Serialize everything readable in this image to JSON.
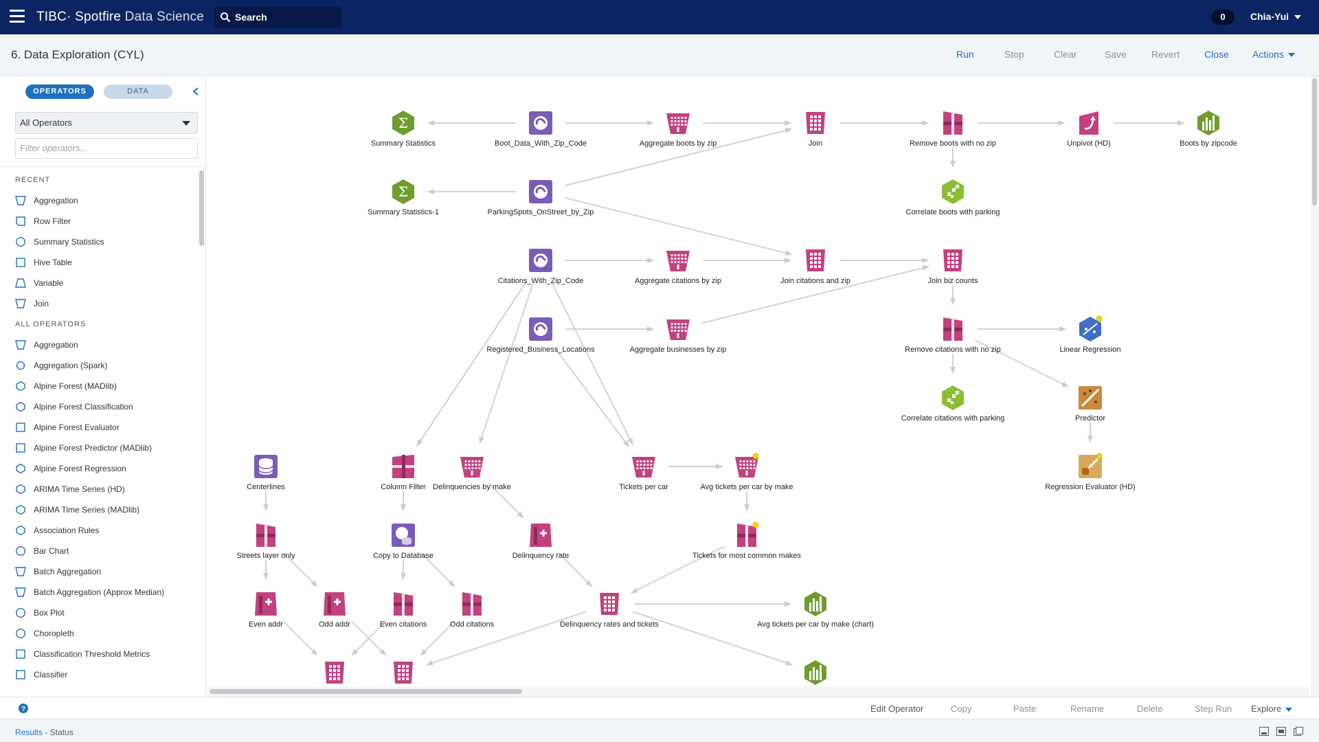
{
  "topbar": {
    "brand_main": "TIBC· Spotfire",
    "brand_sub": "Data Science",
    "search_label": "Search",
    "notifications": "0",
    "user": "Chia-Yui"
  },
  "titlebar": {
    "title": "6. Data Exploration (CYL)",
    "run": "Run",
    "stop": "Stop",
    "clear": "Clear",
    "save": "Save",
    "revert": "Revert",
    "close": "Close",
    "actions": "Actions"
  },
  "sidebar": {
    "tab_operators": "OPERATORS",
    "tab_data": "DATA",
    "select_value": "All Operators",
    "filter_placeholder": "Filter operators...",
    "recent_header": "RECENT",
    "recent": [
      "Aggregation",
      "Row Filter",
      "Summary Statistics",
      "Hive Table",
      "Variable",
      "Join"
    ],
    "all_header": "ALL OPERATORS",
    "all": [
      "Aggregation",
      "Aggregation (Spark)",
      "Alpine Forest (MADlib)",
      "Alpine Forest Classification",
      "Alpine Forest Evaluator",
      "Alpine Forest Predictor (MADlib)",
      "Alpine Forest Regression",
      "ARIMA Time Series (HD)",
      "ARIMA Time Series (MADlib)",
      "Association Rules",
      "Bar Chart",
      "Batch Aggregation",
      "Batch Aggregation (Approx Median)",
      "Box Plot",
      "Choropleth",
      "Classification Threshold Metrics",
      "Classifier"
    ]
  },
  "workflow": {
    "nodes": [
      {
        "label": "Summary Statistics",
        "icon": "sigma-icon"
      },
      {
        "label": "Boot_Data_With_Zip_Code",
        "icon": "dataset-icon"
      },
      {
        "label": "Aggregate boots by zip",
        "icon": "aggregation-icon"
      },
      {
        "label": "Join",
        "icon": "join-icon"
      },
      {
        "label": "Remove boots with no zip",
        "icon": "row-filter-icon"
      },
      {
        "label": "Unpivot (HD)",
        "icon": "unpivot-icon"
      },
      {
        "label": "Boots by zipcode",
        "icon": "bar-chart-icon"
      },
      {
        "label": "Summary Statistics-1",
        "icon": "sigma-icon"
      },
      {
        "label": "ParkingSpots_OnStreet_by_Zip",
        "icon": "dataset-icon"
      },
      {
        "label": "Correlate boots with parking",
        "icon": "correlation-icon"
      },
      {
        "label": "Citations_With_Zip_Code",
        "icon": "dataset-icon"
      },
      {
        "label": "Aggregate citations by zip",
        "icon": "aggregation-icon"
      },
      {
        "label": "Join citations and zip",
        "icon": "join-icon"
      },
      {
        "label": "Join biz counts",
        "icon": "join-icon"
      },
      {
        "label": "Registered_Business_Locations",
        "icon": "dataset-icon"
      },
      {
        "label": "Aggregate businesses by zip",
        "icon": "aggregation-icon"
      },
      {
        "label": "Remove citations with no zip",
        "icon": "row-filter-icon"
      },
      {
        "label": "Linear Regression",
        "icon": "linear-regression-icon"
      },
      {
        "label": "Correlate citations with parking",
        "icon": "correlation-icon"
      },
      {
        "label": "Predictor",
        "icon": "predictor-icon"
      },
      {
        "label": "Regression Evaluator (HD)",
        "icon": "evaluator-icon"
      },
      {
        "label": "Centerlines",
        "icon": "database-icon"
      },
      {
        "label": "Column Filter",
        "icon": "column-filter-icon"
      },
      {
        "label": "Delinquencies by make",
        "icon": "aggregation-icon"
      },
      {
        "label": "Tickets per car",
        "icon": "aggregation-icon"
      },
      {
        "label": "Avg tickets per car by make",
        "icon": "aggregation-icon"
      },
      {
        "label": "Streets layer only",
        "icon": "row-filter-icon"
      },
      {
        "label": "Copy to Database",
        "icon": "copy-database-icon"
      },
      {
        "label": "Delinquency rate",
        "icon": "variable-icon"
      },
      {
        "label": "Tickets for most common makes",
        "icon": "row-filter-icon"
      },
      {
        "label": "Even addr",
        "icon": "variable-icon"
      },
      {
        "label": "Odd addr",
        "icon": "variable-icon"
      },
      {
        "label": "Even citations",
        "icon": "row-filter-icon"
      },
      {
        "label": "Odd citations",
        "icon": "row-filter-icon"
      },
      {
        "label": "Delinquency rates and tickets",
        "icon": "join-icon"
      },
      {
        "label": "Avg tickets per car by make (chart)",
        "icon": "bar-chart-icon"
      },
      {
        "label": "",
        "icon": "join-icon"
      },
      {
        "label": "",
        "icon": "join-icon"
      },
      {
        "label": "",
        "icon": "bar-chart-icon"
      }
    ]
  },
  "bottombar": {
    "edit": "Edit Operator",
    "copy": "Copy",
    "paste": "Paste",
    "rename": "Rename",
    "delete": "Delete",
    "steprun": "Step Run",
    "explore": "Explore"
  },
  "statusbar": {
    "results": "Results",
    "status": " - Status"
  },
  "colors": {
    "nav": "#0c2461",
    "accent": "#1f6fbf",
    "operator_pink": "#c2417f",
    "dataset_purple": "#7b5cb8",
    "chart_green": "#6f9c2e"
  }
}
